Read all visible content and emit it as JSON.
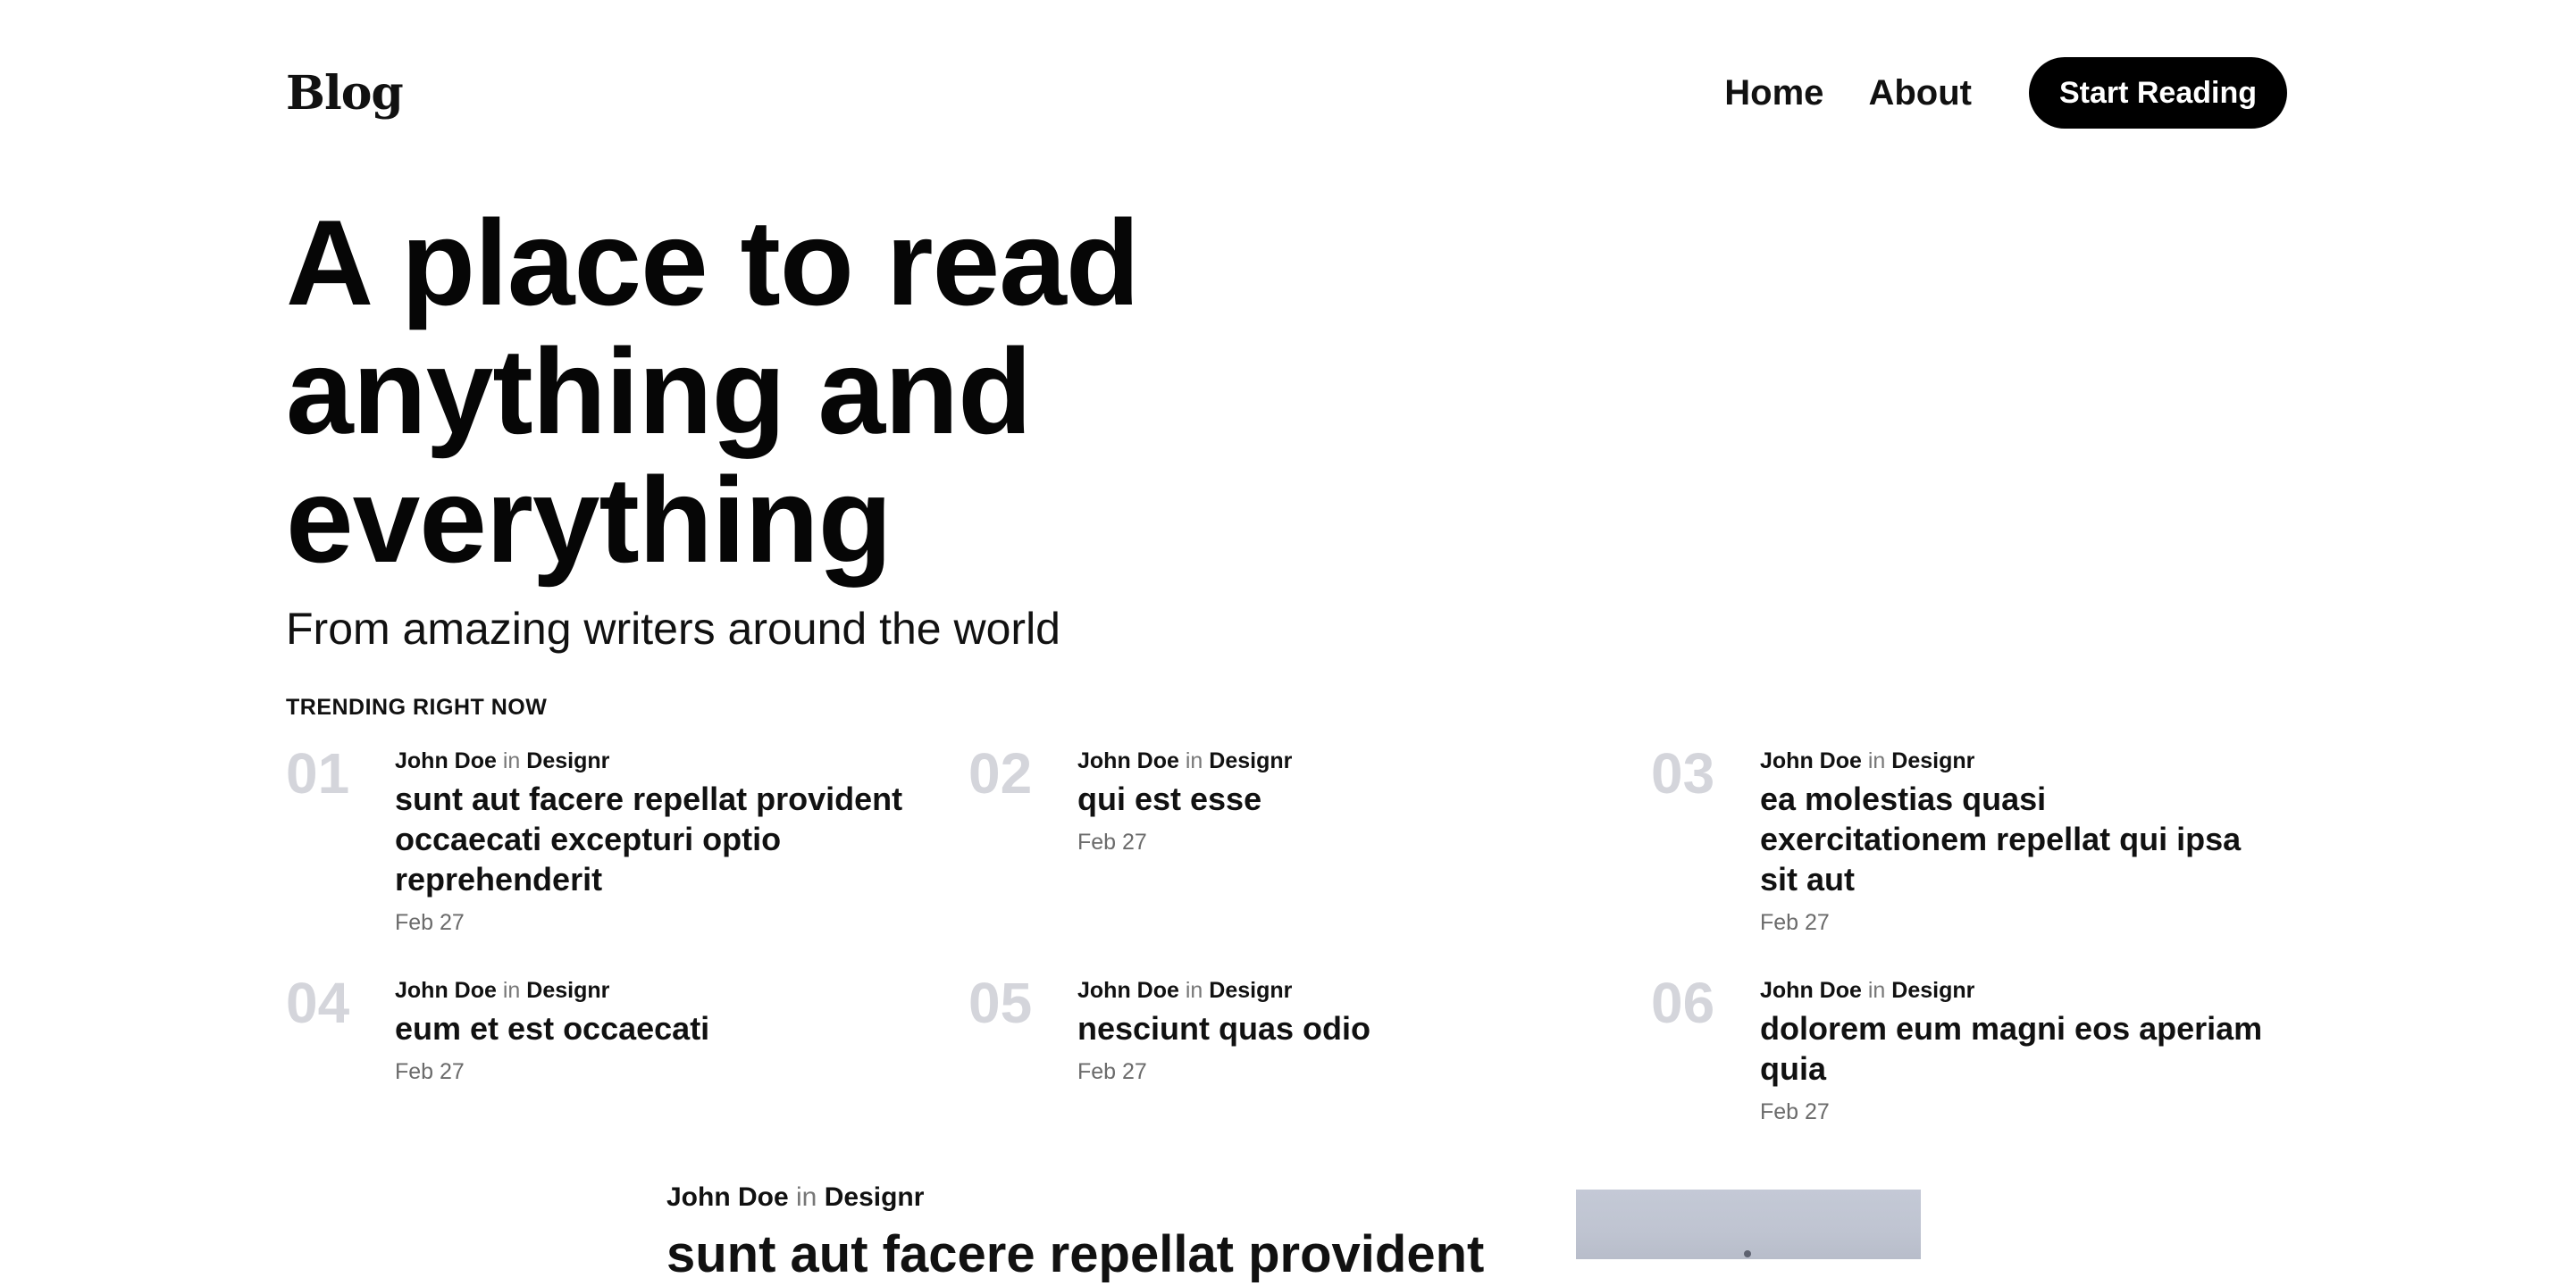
{
  "header": {
    "brand": "Blog",
    "nav": [
      {
        "label": "Home"
      },
      {
        "label": "About"
      }
    ],
    "cta_label": "Start Reading"
  },
  "hero": {
    "title": "A place to read anything and everything",
    "subtitle": "From amazing writers around the world"
  },
  "trending": {
    "label": "TRENDING RIGHT NOW",
    "items": [
      {
        "num": "01",
        "author": "John Doe",
        "in": "in",
        "publication": "Designr",
        "title": "sunt aut facere repellat provident occaecati excepturi optio reprehenderit",
        "date": "Feb 27"
      },
      {
        "num": "02",
        "author": "John Doe",
        "in": "in",
        "publication": "Designr",
        "title": "qui est esse",
        "date": "Feb 27"
      },
      {
        "num": "03",
        "author": "John Doe",
        "in": "in",
        "publication": "Designr",
        "title": "ea molestias quasi exercitationem repellat qui ipsa sit aut",
        "date": "Feb 27"
      },
      {
        "num": "04",
        "author": "John Doe",
        "in": "in",
        "publication": "Designr",
        "title": "eum et est occaecati",
        "date": "Feb 27"
      },
      {
        "num": "05",
        "author": "John Doe",
        "in": "in",
        "publication": "Designr",
        "title": "nesciunt quas odio",
        "date": "Feb 27"
      },
      {
        "num": "06",
        "author": "John Doe",
        "in": "in",
        "publication": "Designr",
        "title": "dolorem eum magni eos aperiam quia",
        "date": "Feb 27"
      }
    ]
  },
  "featured": {
    "author": "John Doe",
    "in": "in",
    "publication": "Designr",
    "title": "sunt aut facere repellat provident"
  },
  "colors": {
    "text": "#111111",
    "muted_number": "#d4d5db",
    "date": "#6b6b6b",
    "cta_bg": "#000000",
    "cta_text": "#ffffff"
  }
}
